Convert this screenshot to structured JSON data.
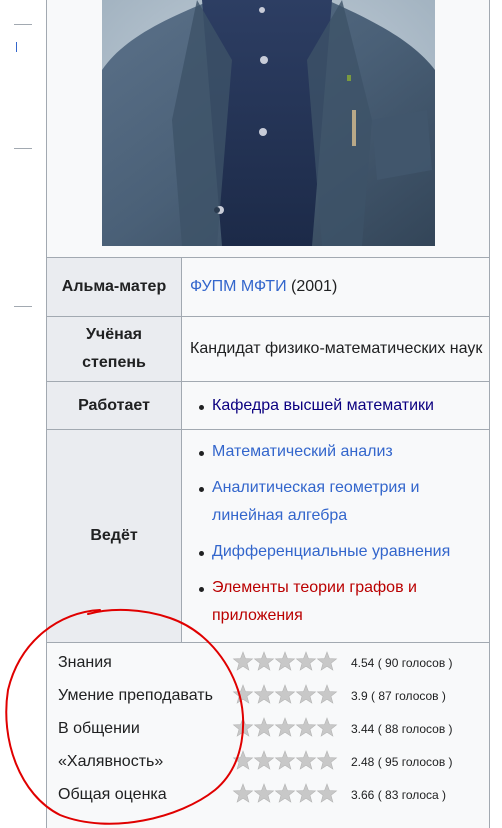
{
  "infobox": {
    "rows": [
      {
        "label": "Альма-матер",
        "link": "ФУПМ МФТИ",
        "extra": "(2001)"
      },
      {
        "label": "Учёная степень",
        "value": "Кандидат физико-математических наук"
      },
      {
        "label": "Работает",
        "items": [
          "Кафедра высшей математики"
        ]
      },
      {
        "label": "Ведёт",
        "items": [
          "Математический анализ",
          "Аналитическая геометрия и линейная алгебра",
          "Дифференциальные уравнения",
          "Элементы теории графов и приложения"
        ]
      }
    ]
  },
  "ratings": [
    {
      "label": "Знания",
      "score": 4.54,
      "text": "4.54 ( 90 голосов )"
    },
    {
      "label": "Умение преподавать",
      "score": 3.9,
      "text": "3.9 ( 87 голосов )"
    },
    {
      "label": "В общении",
      "score": 3.44,
      "text": "3.44 ( 88 голосов )"
    },
    {
      "label": "«Халявность»",
      "score": 2.48,
      "text": "2.48 ( 95 голосов )"
    },
    {
      "label": "Общая оценка",
      "score": 3.66,
      "text": "3.66 ( 83 голоса )"
    }
  ],
  "stars_max": 5,
  "colors": {
    "link": "#3366cc",
    "visited": "#0b0080",
    "redlink": "#ba0000",
    "annotation": "#e00000",
    "star": "#c8c8c8"
  }
}
